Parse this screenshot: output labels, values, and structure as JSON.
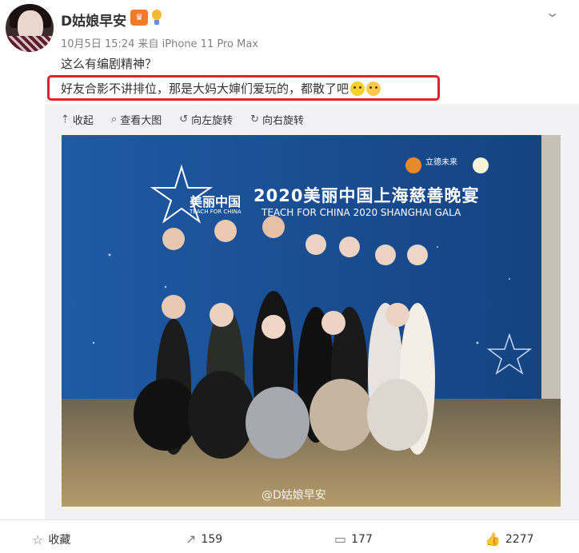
{
  "post": {
    "username": "D姑娘早安",
    "meta": "10月5日 15:24 来自 iPhone 11 Pro Max",
    "text_line1": "这么有编剧精神？",
    "text_line2": "好友合影不讲排位，那是大妈大婶们爱玩的，都散了吧"
  },
  "toolbar": {
    "collapse": "收起",
    "view_large": "查看大图",
    "rotate_left": "向左旋转",
    "rotate_right": "向右旋转"
  },
  "photo": {
    "title_cn": "2020美丽中国上海慈善晚宴",
    "title_en": "TEACH FOR CHINA 2020 SHANGHAI GALA",
    "logo_cn": "美丽中国",
    "logo_en": "TEACH FOR CHINA",
    "sponsor": "立德未来",
    "watermark": "@D姑娘早安"
  },
  "actions": {
    "favorite": "收藏",
    "repost_count": "159",
    "comment_count": "177",
    "like_count": "2277"
  },
  "colors": {
    "highlight": "#e5202b",
    "backdrop": "#1a4f95"
  },
  "icons": [
    "crown-badge-icon",
    "bulb-badge-icon",
    "chevron-down-icon",
    "collapse-icon",
    "magnifier-icon",
    "rotate-left-icon",
    "rotate-right-icon",
    "star-icon",
    "repost-icon",
    "comment-icon",
    "like-icon"
  ]
}
